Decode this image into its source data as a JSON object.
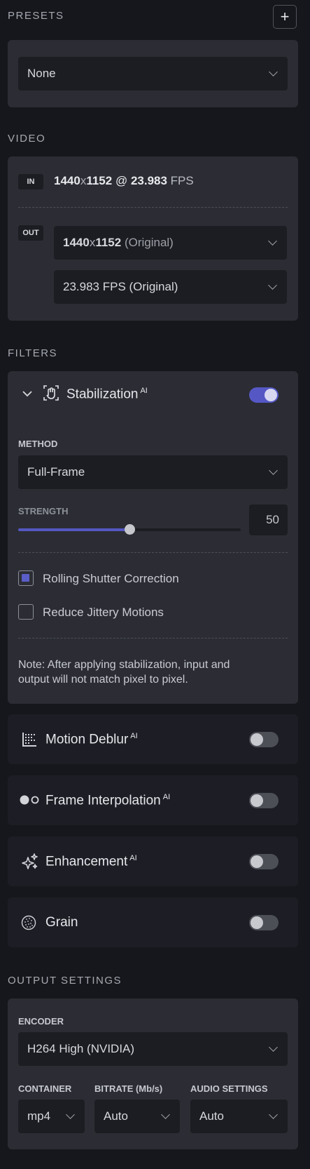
{
  "presets": {
    "title": "PRESETS",
    "add_label": "+",
    "selected": "None"
  },
  "video": {
    "title": "VIDEO",
    "in_tag": "IN",
    "in_res_w": "1440",
    "in_res_x": "x",
    "in_res_h": "1152",
    "in_at": " @ ",
    "in_fps": "23.983",
    "in_fps_unit": " FPS",
    "out_tag": "OUT",
    "out_res_w": "1440",
    "out_res_x": "x",
    "out_res_h": "1152",
    "out_res_note": " (Original)",
    "out_fps": "23.983 FPS (Original)"
  },
  "filters": {
    "title": "FILTERS",
    "ai_badge": "AI",
    "stabilization": {
      "name": "Stabilization",
      "enabled": true,
      "method_label": "METHOD",
      "method_value": "Full-Frame",
      "strength_label": "STRENGTH",
      "strength_value": "50",
      "strength_fraction": 0.5,
      "rolling_shutter_label": "Rolling Shutter Correction",
      "rolling_shutter_checked": true,
      "reduce_jitter_label": "Reduce Jittery Motions",
      "reduce_jitter_checked": false,
      "note_line1": "Note: After applying stabilization, input and",
      "note_line2": "output will not match pixel to pixel."
    },
    "motion_deblur": {
      "name": "Motion Deblur",
      "enabled": false
    },
    "frame_interpolation": {
      "name": "Frame Interpolation",
      "enabled": false
    },
    "enhancement": {
      "name": "Enhancement",
      "enabled": false
    },
    "grain": {
      "name": "Grain",
      "enabled": false
    }
  },
  "output": {
    "title": "OUTPUT SETTINGS",
    "encoder_label": "ENCODER",
    "encoder_value": "H264 High (NVIDIA)",
    "container_label": "CONTAINER",
    "container_value": "mp4",
    "bitrate_label": "BITRATE (Mb/s)",
    "bitrate_value": "Auto",
    "audio_label": "AUDIO SETTINGS",
    "audio_value": "Auto"
  },
  "colors": {
    "background": "#16171c",
    "card": "#2c2d34",
    "accent": "#5558c4"
  }
}
